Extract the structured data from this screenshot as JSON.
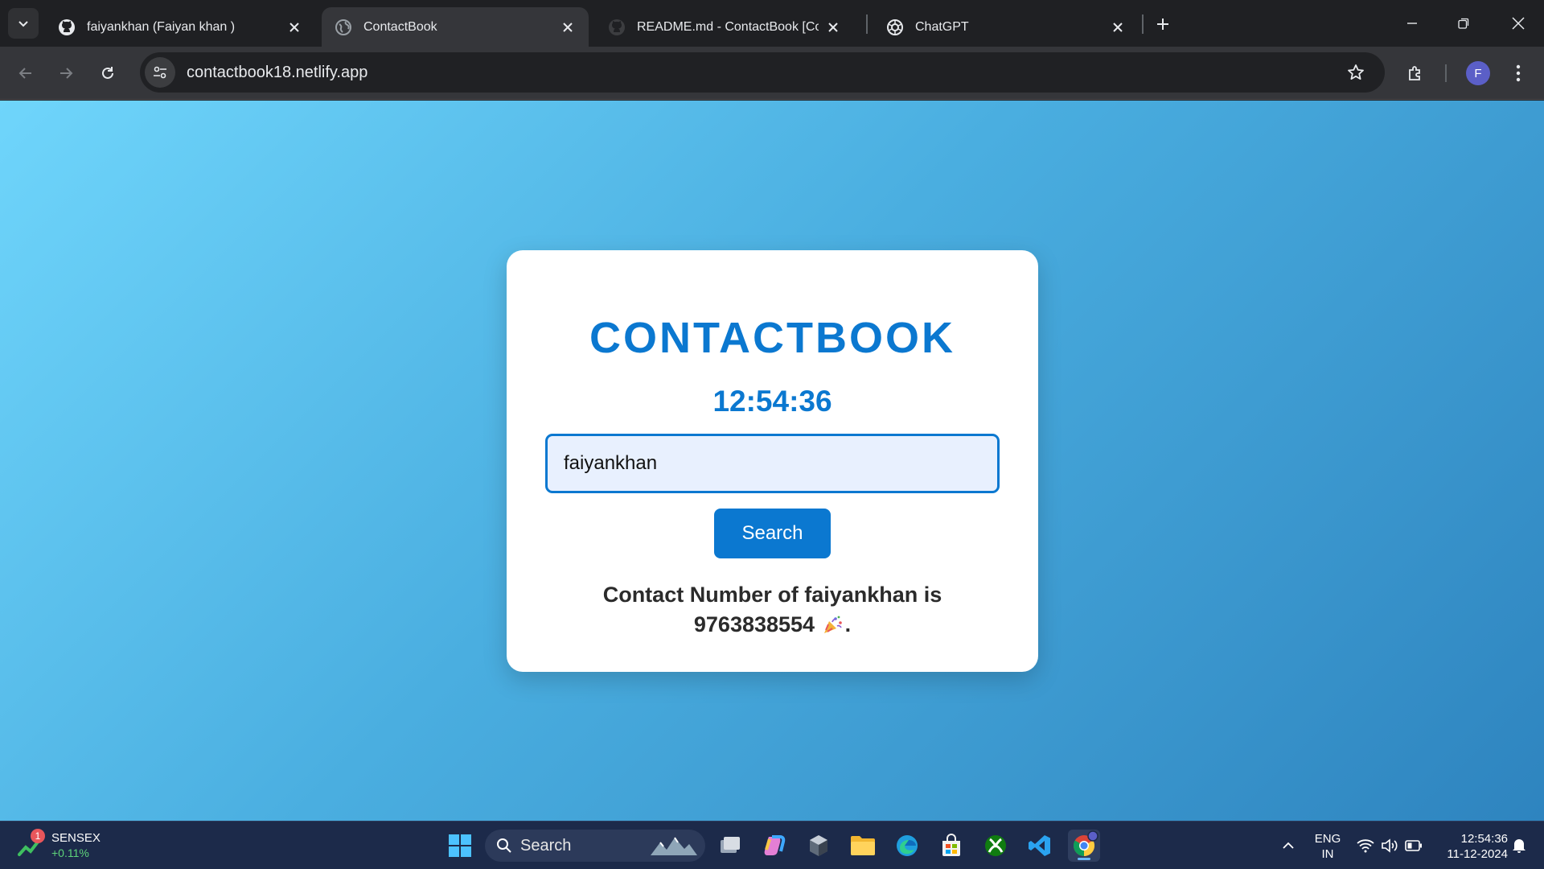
{
  "browser": {
    "tabs": [
      {
        "title": "faiyankhan (Faiyan khan )",
        "icon": "github-icon",
        "active": false
      },
      {
        "title": "ContactBook",
        "icon": "globe-icon",
        "active": true
      },
      {
        "title": "README.md - ContactBook [Code",
        "icon": "github-icon",
        "active": false
      },
      {
        "title": "ChatGPT",
        "icon": "chatgpt-icon",
        "active": false
      }
    ],
    "url": "contactbook18.netlify.app",
    "profile_initial": "F"
  },
  "page": {
    "title": "CONTACTBOOK",
    "clock": "12:54:36",
    "search_value": "faiyankhan",
    "search_button": "Search",
    "result_line1": "Contact Number of faiyankhan is",
    "result_number": "9763838554",
    "result_end": ".",
    "accent_color": "#0b78d0"
  },
  "taskbar": {
    "widget": {
      "badge": "1",
      "title": "SENSEX",
      "value": "+0.11%"
    },
    "search_label": "Search",
    "pinned_apps": [
      "task-view-icon",
      "copilot-icon",
      "app-icon",
      "file-explorer-icon",
      "edge-icon",
      "store-icon",
      "xbox-icon",
      "vscode-icon",
      "chrome-icon"
    ],
    "language_line1": "ENG",
    "language_line2": "IN",
    "time": "12:54:36",
    "date": "11-12-2024"
  }
}
